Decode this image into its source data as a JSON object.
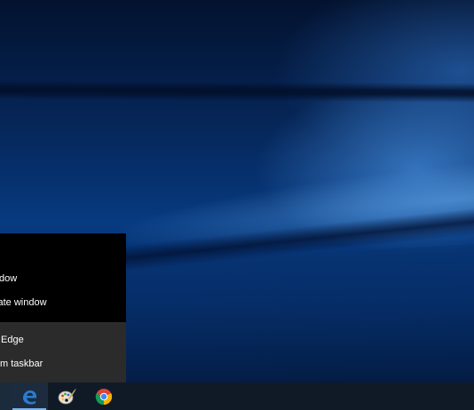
{
  "jump_list": {
    "tasks": [
      {
        "label": "New window",
        "visible_fragment": "dow",
        "icon": "edge-window-icon"
      },
      {
        "label": "New InPrivate window",
        "visible_fragment": "vate window",
        "icon": "inprivate-icon"
      }
    ],
    "app_actions": [
      {
        "label": "Microsoft Edge",
        "visible_fragment": "Edge",
        "icon": "edge-icon"
      },
      {
        "label": "Unpin from taskbar",
        "visible_fragment": "m taskbar",
        "icon": "unpin-icon"
      }
    ]
  },
  "taskbar": {
    "pinned": [
      {
        "name": "Microsoft Edge",
        "icon": "edge-icon",
        "active": true
      },
      {
        "name": "Paint",
        "icon": "paint-palette-icon",
        "active": false
      },
      {
        "name": "Google Chrome",
        "icon": "chrome-icon",
        "active": false
      }
    ]
  },
  "colors": {
    "taskbar_bg": "#101a26",
    "jumplist_top_bg": "#000000",
    "jumplist_bottom_bg": "#2b2b2b",
    "edge_blue": "#2a7ccf",
    "active_underline": "#7fb2e6"
  }
}
